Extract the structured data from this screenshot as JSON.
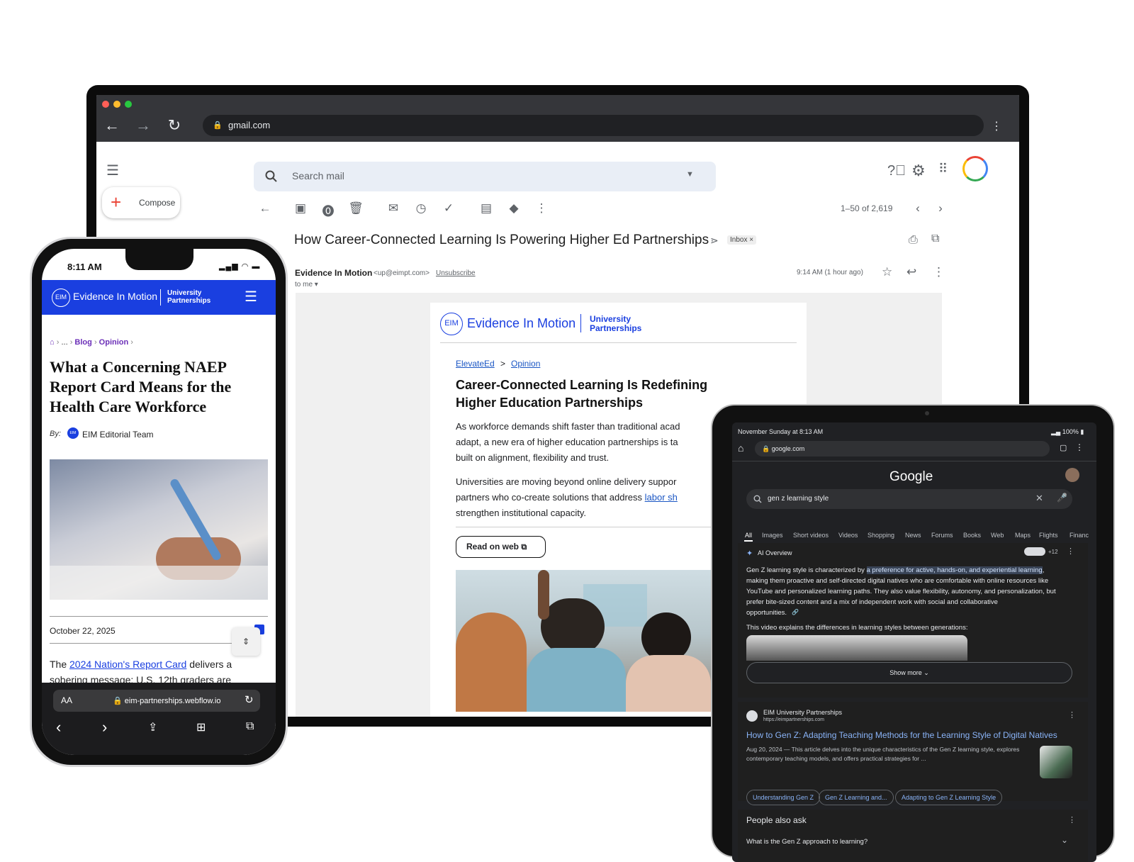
{
  "laptop": {
    "url": "gmail.com",
    "search_placeholder": "Search mail",
    "compose_label": "Compose",
    "pagination": "1–50 of 2,619",
    "subject": "How Career-Connected Learning Is Powering Higher Ed Partnerships",
    "inbox_label": "Inbox",
    "inbox_close": "×",
    "sender_name": "Evidence In Motion",
    "sender_email": "<up@eimpt.com>",
    "unsubscribe": "Unsubscribe",
    "to_me": "to me",
    "timestamp": "9:14 AM (1 hour ago)",
    "email": {
      "logo_mark": "EIM",
      "logo_name": "Evidence In Motion",
      "logo_sub1": "University",
      "logo_sub2": "Partnerships",
      "crumb1": "ElevateEd",
      "crumb_sep": ">",
      "crumb2": "Opinion",
      "headline1": "Career-Connected Learning Is Redefining",
      "headline2": "Higher Education Partnerships",
      "p1_l1": "As workforce demands shift faster than traditional acad",
      "p1_l2": "adapt, a new era of higher education partnerships is ta",
      "p1_l3": "built on alignment, flexibility and trust.",
      "p2_l1": "Universities are moving beyond online delivery suppor",
      "p2_l2": "partners who co-create solutions that address ",
      "p2_link": "labor sh",
      "p2_l3": "strengthen institutional capacity.",
      "read_btn": "Read on web"
    }
  },
  "phone": {
    "time": "8:11 AM",
    "logo_mark": "EIM",
    "logo_name": "Evidence In Motion",
    "logo_sub1": "University",
    "logo_sub2": "Partnerships",
    "crumb_ellipsis": "...",
    "crumb_blog": "Blog",
    "crumb_opinion": "Opinion",
    "title1": "What a Concerning NAEP",
    "title2": "Report Card Means for the",
    "title3": "Health Care Workforce",
    "by_label": "By:",
    "author_mark": "EIM",
    "author": "EIM Editorial Team",
    "date": "October 22, 2025",
    "body_pre": "The ",
    "body_link": "2024 Nation's Report Card",
    "body_post": " delivers a",
    "body_l2": "sobering message: U.S. 12th graders are",
    "text_size": "AA",
    "url": "eim-partnerships.webflow.io"
  },
  "tablet": {
    "status_left": "November Sunday at 8:13 AM",
    "status_right": "100%",
    "url": "google.com",
    "google_logo": "Google",
    "query": "gen z learning style",
    "tabs": [
      "All",
      "Images",
      "Short videos",
      "Videos",
      "Shopping",
      "News",
      "Forums",
      "Books",
      "Web",
      "Maps",
      "Flights",
      "Financ"
    ],
    "ai_label": "AI Overview",
    "ai_count": "+12",
    "ai_pre": "Gen Z learning style is characterized by ",
    "ai_highlight": "a preference for active, hands-on, and experiential learning",
    "ai_post": ",",
    "ai_l2": "making them proactive and self-directed digital natives who are comfortable with online resources like",
    "ai_l3": "YouTube and personalized learning paths. They also value flexibility, autonomy, and personalization, but",
    "ai_l4": "prefer bite-sized content and a mix of independent work with social and collaborative",
    "ai_l5": "opportunities.",
    "video_note": "This video explains the differences in learning styles between generations:",
    "show_more": "Show more",
    "result_site": "EIM University Partnerships",
    "result_url": "https://eimpartnerships.com",
    "result_title": "How to Gen Z: Adapting Teaching Methods for the Learning Style of Digital Natives",
    "result_snip1": "Aug 20, 2024 — This article delves into the unique characteristics of the Gen Z learning style, explores",
    "result_snip2": "contemporary teaching models, and offers practical strategies for ...",
    "chips": [
      "Understanding Gen Z",
      "Gen Z Learning and...",
      "Adapting to Gen Z Learning Style"
    ],
    "paa_title": "People also ask",
    "paa_q1": "What is the Gen Z approach to learning?"
  },
  "colors": {
    "eim_blue": "#1a3fe0",
    "gmail_bg": "#ffffff",
    "google_dark": "#202124",
    "link_blue": "#8ab4f8"
  }
}
